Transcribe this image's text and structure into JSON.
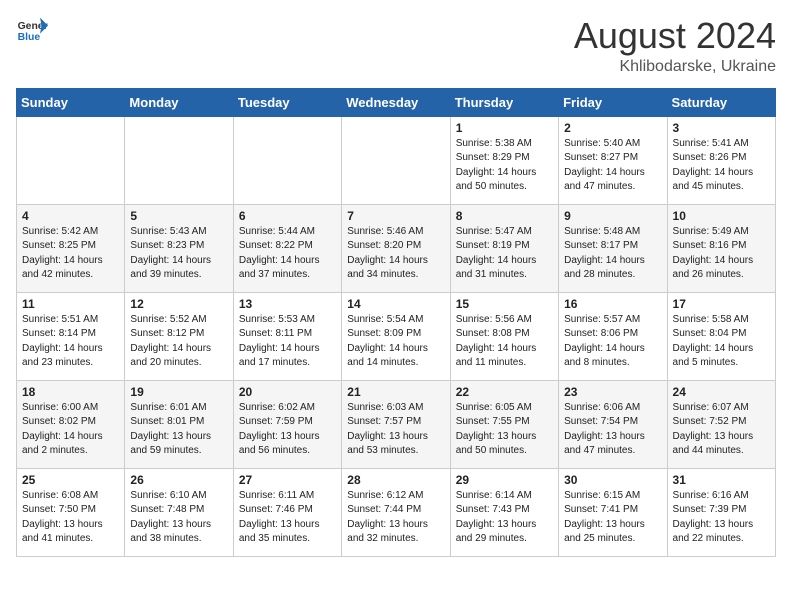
{
  "header": {
    "logo_line1": "General",
    "logo_line2": "Blue",
    "month_year": "August 2024",
    "location": "Khlibodarske, Ukraine"
  },
  "days_of_week": [
    "Sunday",
    "Monday",
    "Tuesday",
    "Wednesday",
    "Thursday",
    "Friday",
    "Saturday"
  ],
  "weeks": [
    [
      {
        "day": "",
        "sunrise": "",
        "sunset": "",
        "daylight": ""
      },
      {
        "day": "",
        "sunrise": "",
        "sunset": "",
        "daylight": ""
      },
      {
        "day": "",
        "sunrise": "",
        "sunset": "",
        "daylight": ""
      },
      {
        "day": "",
        "sunrise": "",
        "sunset": "",
        "daylight": ""
      },
      {
        "day": "1",
        "sunrise": "Sunrise: 5:38 AM",
        "sunset": "Sunset: 8:29 PM",
        "daylight": "Daylight: 14 hours and 50 minutes."
      },
      {
        "day": "2",
        "sunrise": "Sunrise: 5:40 AM",
        "sunset": "Sunset: 8:27 PM",
        "daylight": "Daylight: 14 hours and 47 minutes."
      },
      {
        "day": "3",
        "sunrise": "Sunrise: 5:41 AM",
        "sunset": "Sunset: 8:26 PM",
        "daylight": "Daylight: 14 hours and 45 minutes."
      }
    ],
    [
      {
        "day": "4",
        "sunrise": "Sunrise: 5:42 AM",
        "sunset": "Sunset: 8:25 PM",
        "daylight": "Daylight: 14 hours and 42 minutes."
      },
      {
        "day": "5",
        "sunrise": "Sunrise: 5:43 AM",
        "sunset": "Sunset: 8:23 PM",
        "daylight": "Daylight: 14 hours and 39 minutes."
      },
      {
        "day": "6",
        "sunrise": "Sunrise: 5:44 AM",
        "sunset": "Sunset: 8:22 PM",
        "daylight": "Daylight: 14 hours and 37 minutes."
      },
      {
        "day": "7",
        "sunrise": "Sunrise: 5:46 AM",
        "sunset": "Sunset: 8:20 PM",
        "daylight": "Daylight: 14 hours and 34 minutes."
      },
      {
        "day": "8",
        "sunrise": "Sunrise: 5:47 AM",
        "sunset": "Sunset: 8:19 PM",
        "daylight": "Daylight: 14 hours and 31 minutes."
      },
      {
        "day": "9",
        "sunrise": "Sunrise: 5:48 AM",
        "sunset": "Sunset: 8:17 PM",
        "daylight": "Daylight: 14 hours and 28 minutes."
      },
      {
        "day": "10",
        "sunrise": "Sunrise: 5:49 AM",
        "sunset": "Sunset: 8:16 PM",
        "daylight": "Daylight: 14 hours and 26 minutes."
      }
    ],
    [
      {
        "day": "11",
        "sunrise": "Sunrise: 5:51 AM",
        "sunset": "Sunset: 8:14 PM",
        "daylight": "Daylight: 14 hours and 23 minutes."
      },
      {
        "day": "12",
        "sunrise": "Sunrise: 5:52 AM",
        "sunset": "Sunset: 8:12 PM",
        "daylight": "Daylight: 14 hours and 20 minutes."
      },
      {
        "day": "13",
        "sunrise": "Sunrise: 5:53 AM",
        "sunset": "Sunset: 8:11 PM",
        "daylight": "Daylight: 14 hours and 17 minutes."
      },
      {
        "day": "14",
        "sunrise": "Sunrise: 5:54 AM",
        "sunset": "Sunset: 8:09 PM",
        "daylight": "Daylight: 14 hours and 14 minutes."
      },
      {
        "day": "15",
        "sunrise": "Sunrise: 5:56 AM",
        "sunset": "Sunset: 8:08 PM",
        "daylight": "Daylight: 14 hours and 11 minutes."
      },
      {
        "day": "16",
        "sunrise": "Sunrise: 5:57 AM",
        "sunset": "Sunset: 8:06 PM",
        "daylight": "Daylight: 14 hours and 8 minutes."
      },
      {
        "day": "17",
        "sunrise": "Sunrise: 5:58 AM",
        "sunset": "Sunset: 8:04 PM",
        "daylight": "Daylight: 14 hours and 5 minutes."
      }
    ],
    [
      {
        "day": "18",
        "sunrise": "Sunrise: 6:00 AM",
        "sunset": "Sunset: 8:02 PM",
        "daylight": "Daylight: 14 hours and 2 minutes."
      },
      {
        "day": "19",
        "sunrise": "Sunrise: 6:01 AM",
        "sunset": "Sunset: 8:01 PM",
        "daylight": "Daylight: 13 hours and 59 minutes."
      },
      {
        "day": "20",
        "sunrise": "Sunrise: 6:02 AM",
        "sunset": "Sunset: 7:59 PM",
        "daylight": "Daylight: 13 hours and 56 minutes."
      },
      {
        "day": "21",
        "sunrise": "Sunrise: 6:03 AM",
        "sunset": "Sunset: 7:57 PM",
        "daylight": "Daylight: 13 hours and 53 minutes."
      },
      {
        "day": "22",
        "sunrise": "Sunrise: 6:05 AM",
        "sunset": "Sunset: 7:55 PM",
        "daylight": "Daylight: 13 hours and 50 minutes."
      },
      {
        "day": "23",
        "sunrise": "Sunrise: 6:06 AM",
        "sunset": "Sunset: 7:54 PM",
        "daylight": "Daylight: 13 hours and 47 minutes."
      },
      {
        "day": "24",
        "sunrise": "Sunrise: 6:07 AM",
        "sunset": "Sunset: 7:52 PM",
        "daylight": "Daylight: 13 hours and 44 minutes."
      }
    ],
    [
      {
        "day": "25",
        "sunrise": "Sunrise: 6:08 AM",
        "sunset": "Sunset: 7:50 PM",
        "daylight": "Daylight: 13 hours and 41 minutes."
      },
      {
        "day": "26",
        "sunrise": "Sunrise: 6:10 AM",
        "sunset": "Sunset: 7:48 PM",
        "daylight": "Daylight: 13 hours and 38 minutes."
      },
      {
        "day": "27",
        "sunrise": "Sunrise: 6:11 AM",
        "sunset": "Sunset: 7:46 PM",
        "daylight": "Daylight: 13 hours and 35 minutes."
      },
      {
        "day": "28",
        "sunrise": "Sunrise: 6:12 AM",
        "sunset": "Sunset: 7:44 PM",
        "daylight": "Daylight: 13 hours and 32 minutes."
      },
      {
        "day": "29",
        "sunrise": "Sunrise: 6:14 AM",
        "sunset": "Sunset: 7:43 PM",
        "daylight": "Daylight: 13 hours and 29 minutes."
      },
      {
        "day": "30",
        "sunrise": "Sunrise: 6:15 AM",
        "sunset": "Sunset: 7:41 PM",
        "daylight": "Daylight: 13 hours and 25 minutes."
      },
      {
        "day": "31",
        "sunrise": "Sunrise: 6:16 AM",
        "sunset": "Sunset: 7:39 PM",
        "daylight": "Daylight: 13 hours and 22 minutes."
      }
    ]
  ]
}
